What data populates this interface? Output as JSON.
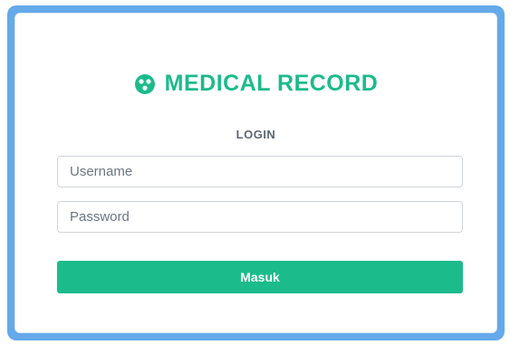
{
  "brand": {
    "title": "MEDICAL RECORD",
    "icon": "medical-circle-icon",
    "color": "#1cbb8c"
  },
  "login": {
    "heading": "LOGIN",
    "username_placeholder": "Username",
    "password_placeholder": "Password",
    "submit_label": "Masuk"
  },
  "colors": {
    "frame": "#64a9ea",
    "accent": "#1cbb8c"
  }
}
